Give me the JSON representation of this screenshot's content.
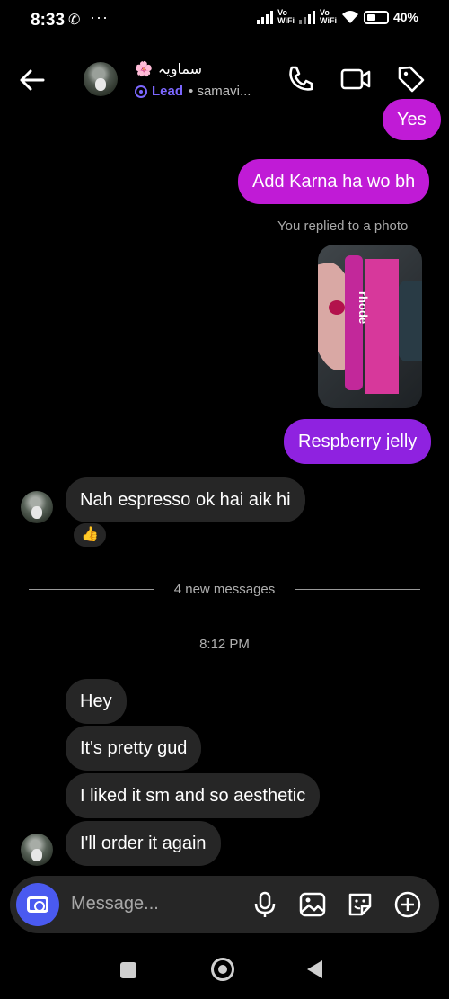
{
  "status_bar": {
    "time": "8:33",
    "battery": "40%",
    "vo": "Vo",
    "wifi_label": "WiFi"
  },
  "header": {
    "name": "سماویہ",
    "flower": "🌸",
    "lead_label": "Lead",
    "handle": "samavi..."
  },
  "messages": {
    "m1": "Yes",
    "m2": "Add Karna ha wo bh",
    "replied_note": "You replied to a photo",
    "m3": "Respberry jelly",
    "m4": "Nah espresso ok hai aik hi",
    "reaction": "👍",
    "photo_brand": "rhode",
    "divider": "4 new messages",
    "time": "8:12 PM",
    "m5": "Hey",
    "m6": "It's pretty gud",
    "m7": "I liked it sm and so aesthetic",
    "m8": "I'll order it again"
  },
  "composer": {
    "placeholder": "Message..."
  },
  "colors": {
    "outgoing_1": "#c01bd6",
    "outgoing_2": "#8f22e0",
    "incoming": "#262626",
    "accent": "#4a5af0",
    "lead": "#7c67ff"
  }
}
